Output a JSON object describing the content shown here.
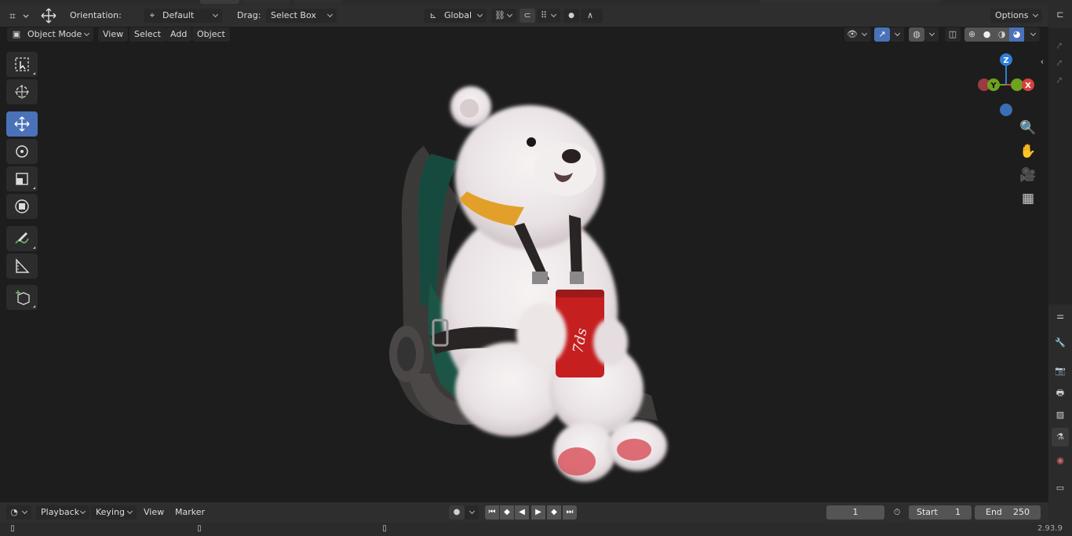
{
  "header": {
    "orientation_label": "Orientation:",
    "orientation_value": "Default",
    "drag_label": "Drag:",
    "drag_value": "Select Box",
    "transform_orientation": "Global",
    "options_label": "Options"
  },
  "viewport_header": {
    "mode": "Object Mode",
    "menus": [
      "View",
      "Select",
      "Add",
      "Object"
    ]
  },
  "gizmo": {
    "z": "Z",
    "y": "Y",
    "x": "X"
  },
  "timeline": {
    "menus": [
      "Playback",
      "Keying",
      "View",
      "Marker"
    ],
    "current_frame": "1",
    "start_label": "Start",
    "start_value": "1",
    "end_label": "End",
    "end_value": "250"
  },
  "status": {
    "version": "2.93.9"
  },
  "colors": {
    "accent": "#4a72b8",
    "gizmo_x": "#d6403f",
    "gizmo_y": "#6ea21f",
    "gizmo_z": "#2e7fd6"
  },
  "icons": [
    "editor-type-icon",
    "transform-move-icon",
    "orientation-icon",
    "snap-icon",
    "proportional-icon",
    "visibility-icon",
    "gizmo-icon",
    "overlay-icon",
    "xray-icon",
    "shading-wireframe-icon",
    "shading-solid-icon",
    "shading-material-icon",
    "shading-rendered-icon",
    "zoom-icon",
    "hand-icon",
    "camera-icon",
    "grid-icon",
    "outliner-icon",
    "tool-icon",
    "render-icon",
    "output-icon",
    "view-layer-icon",
    "scene-icon",
    "world-icon",
    "collection-icon"
  ]
}
